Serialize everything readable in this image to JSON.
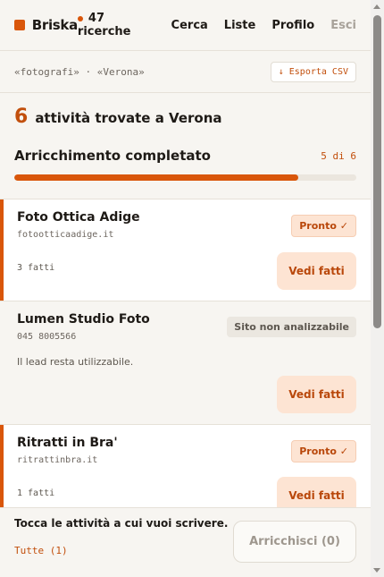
{
  "header": {
    "brand": "Briska",
    "searches": "47 ricerche",
    "nav": [
      "Cerca",
      "Liste",
      "Profilo",
      "Esci"
    ]
  },
  "crumbs": {
    "text": "«fotografi» · «Verona»",
    "export_label": "↓ Esporta CSV"
  },
  "summary": {
    "count": "6",
    "count_label": "attività trovate a Verona",
    "enrich_title": "Arricchimento completato",
    "enrich_count": "5 di 6",
    "progress": 0.83
  },
  "cards": [
    {
      "name": "Foto Ottica Adige",
      "sub": "fotootticaadige.it",
      "badge": "Pronto ✓",
      "facts": "3 fatti",
      "button": "Vedi fatti"
    },
    {
      "name": "Lumen Studio Foto",
      "sub": "045 8005566",
      "badge": "Sito non analizzabile",
      "note": "Il lead resta utilizzabile.",
      "button": "Vedi fatti"
    },
    {
      "name": "Ritratti in Bra'",
      "sub": "ritrattinbra.it",
      "badge": "Pronto ✓",
      "facts": "1 fatti",
      "button": "Vedi fatti"
    }
  ],
  "footer": {
    "hint": "Tocca le attività a cui vuoi scrivere.",
    "all_label": "Tutte (1)",
    "enrich_button": "Arricchisci (0)"
  },
  "colors": {
    "accent": "#d9560a",
    "accent_soft": "#fde4d3",
    "background": "#f7f5f1"
  }
}
